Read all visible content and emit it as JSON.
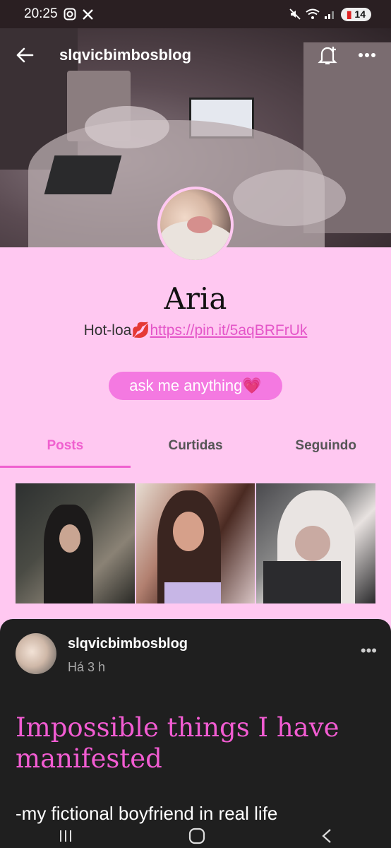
{
  "status_bar": {
    "time": "20:25",
    "battery": "14"
  },
  "header": {
    "blog_name": "slqvicbimbosblog"
  },
  "profile": {
    "name": "Aria",
    "description_prefix": "Hot-loa💋",
    "link_text": "https://pin.it/5aqBRFrUk",
    "ask_button": "ask me anything💗"
  },
  "tabs": [
    {
      "label": "Posts",
      "active": true
    },
    {
      "label": "Curtidas",
      "active": false
    },
    {
      "label": "Seguindo",
      "active": false
    }
  ],
  "post": {
    "username": "slqvicbimbosblog",
    "time": "Há 3 h",
    "more": "•••",
    "title": "Impossible things I have manifested",
    "body": "-my fictional boyfriend in real life"
  },
  "colors": {
    "background": "#ffc8f1",
    "accent": "#f060cf",
    "button": "#f479e1",
    "link": "#e455c8",
    "post_bg": "#1f1f1f"
  }
}
